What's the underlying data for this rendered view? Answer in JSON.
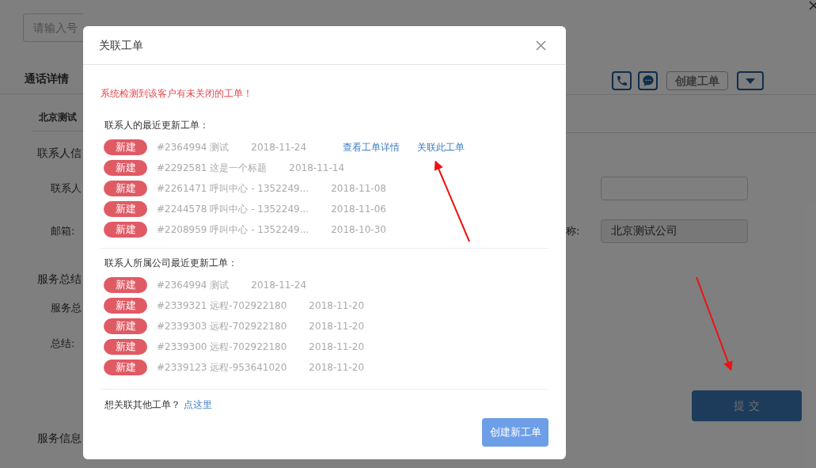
{
  "background": {
    "search": {
      "placeholder": "请输入号"
    },
    "tab_title": "通话详情",
    "create_ticket_button": "创建工单",
    "company_heading": "北京测试",
    "left_labels": [
      {
        "kind": "group",
        "text": "联系人信"
      },
      {
        "kind": "field",
        "text": "联系人"
      },
      {
        "kind": "field",
        "text": "邮箱:"
      },
      {
        "kind": "group",
        "text": "服务总结"
      },
      {
        "kind": "field",
        "text": "服务总"
      },
      {
        "kind": "field",
        "text": "总结:"
      },
      {
        "kind": "group",
        "text": "服务信息"
      }
    ],
    "company_label": "称:",
    "company_field": {
      "value": "北京测试公司"
    },
    "submit_button": "提 交"
  },
  "dialog": {
    "title": "关联工单",
    "warning": "系统检测到该客户有未关闭的工单！",
    "sections": [
      {
        "heading": "联系人的最近更新工单：",
        "tickets": [
          {
            "status": "新建",
            "title": "#2364994 测试",
            "date": "2018-11-24",
            "links": [
              "查看工单详情",
              "关联此工单"
            ]
          },
          {
            "status": "新建",
            "title": "#2292581 这是一个标题",
            "date": "2018-11-14"
          },
          {
            "status": "新建",
            "title": "#2261471 呼叫中心 - 1352249...",
            "date": "2018-11-08"
          },
          {
            "status": "新建",
            "title": "#2244578 呼叫中心 - 1352249...",
            "date": "2018-11-06"
          },
          {
            "status": "新建",
            "title": "#2208959 呼叫中心 - 1352249...",
            "date": "2018-10-30"
          }
        ]
      },
      {
        "heading": "联系人所属公司最近更新工单：",
        "tickets": [
          {
            "status": "新建",
            "title": "#2364994 测试",
            "date": "2018-11-24"
          },
          {
            "status": "新建",
            "title": "#2339321 远程-702922180",
            "date": "2018-11-20"
          },
          {
            "status": "新建",
            "title": "#2339303 远程-702922180",
            "date": "2018-11-20"
          },
          {
            "status": "新建",
            "title": "#2339300 远程-702922180",
            "date": "2018-11-20"
          },
          {
            "status": "新建",
            "title": "#2339123 远程-953641020",
            "date": "2018-11-20"
          }
        ]
      }
    ],
    "footer_text": "想关联其他工单？",
    "footer_link": "点这里",
    "create_button": "创建新工单"
  }
}
